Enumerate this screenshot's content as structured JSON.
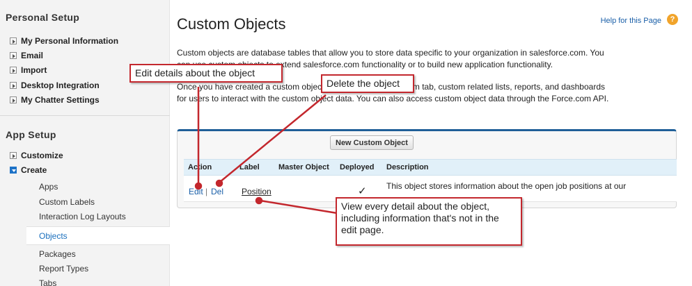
{
  "sidebar": {
    "personal_setup_title": "Personal Setup",
    "personal_items": [
      {
        "label": "My Personal Information"
      },
      {
        "label": "Email"
      },
      {
        "label": "Import"
      },
      {
        "label": "Desktop Integration"
      },
      {
        "label": "My Chatter Settings"
      }
    ],
    "app_setup_title": "App Setup",
    "app_items": [
      {
        "label": "Customize",
        "expanded": false
      },
      {
        "label": "Create",
        "expanded": true
      }
    ],
    "create_children": [
      {
        "label": "Apps"
      },
      {
        "label": "Custom Labels"
      },
      {
        "label": "Interaction Log Layouts"
      },
      {
        "label": "Objects",
        "selected": true
      },
      {
        "label": "Packages"
      },
      {
        "label": "Report Types"
      },
      {
        "label": "Tabs"
      }
    ]
  },
  "main": {
    "title": "Custom Objects",
    "help_link": "Help for this Page",
    "help_icon": "question-icon",
    "description_lines": [
      "Custom objects are database tables that allow you to store data specific to your organization in salesforce.com. You",
      "can use custom objects to extend salesforce.com functionality or to build new application functionality.",
      "Once you have created a custom object, you can create a custom tab, custom related lists, reports, and dashboards",
      "for users to interact with the custom object data. You can also access custom object data through the Force.com API."
    ],
    "new_button": "New Custom Object",
    "table": {
      "headers": [
        "Action",
        "Label",
        "Master Object",
        "Deployed",
        "Description"
      ],
      "rows": [
        {
          "action_edit": "Edit",
          "action_sep": "|",
          "action_del": "Del",
          "label": "Position",
          "master_object": "",
          "deployed": "✓",
          "description": "This object stores information about the open job positions at our"
        }
      ]
    }
  },
  "callouts": {
    "edit": "Edit details about the object",
    "delete": "Delete the object",
    "view": "View every detail about the object, including  information that's not  in the edit page."
  },
  "colors": {
    "callout_border": "#c3272d",
    "panel_accent": "#1f5f98",
    "link": "#1a5fa8",
    "twisty_open": "#1d72c7"
  }
}
